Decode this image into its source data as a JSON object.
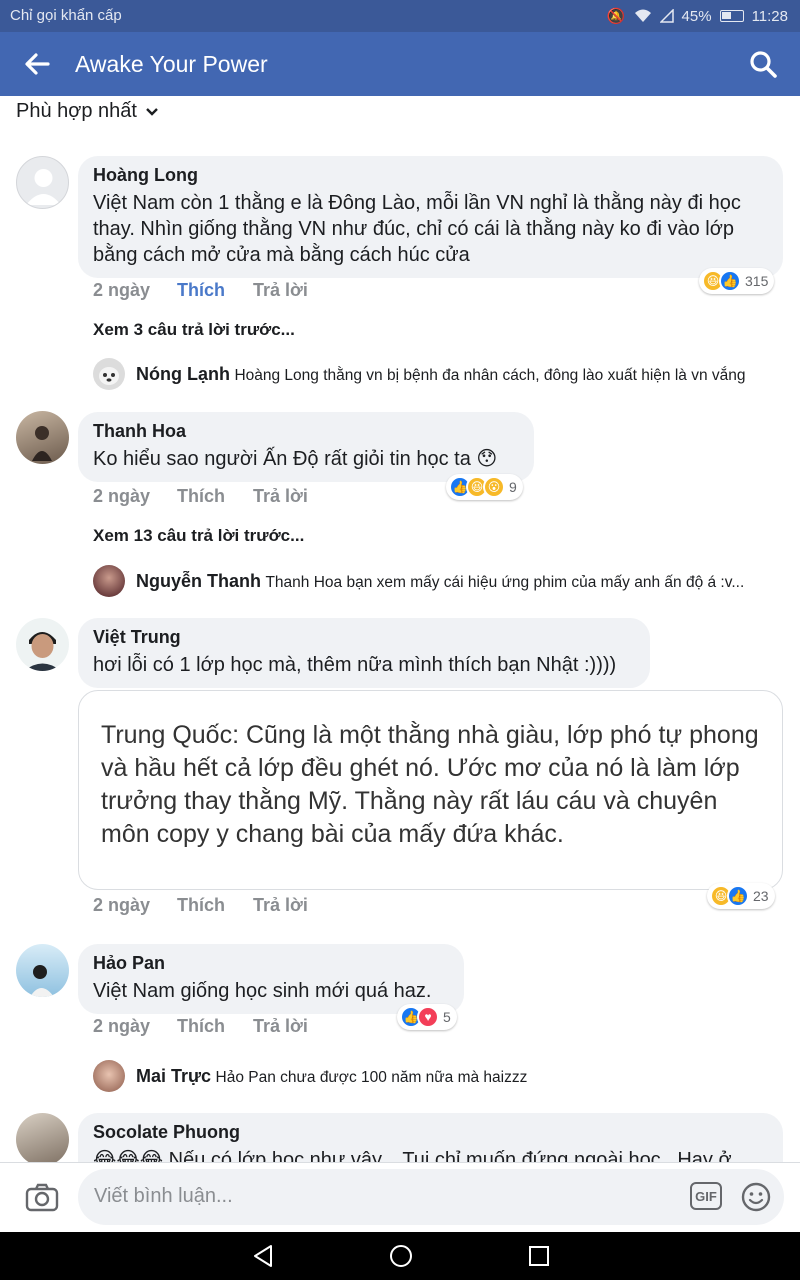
{
  "status_bar": {
    "carrier": "Chỉ gọi khẩn cấp",
    "battery": "45%",
    "time": "11:28"
  },
  "header": {
    "title": "Awake Your Power",
    "back_icon": "arrow-left-icon",
    "search_icon": "search-icon"
  },
  "sort": {
    "label": "Phù hợp nhất"
  },
  "actions": {
    "time": "2 ngày",
    "like": "Thích",
    "reply": "Trả lời"
  },
  "comments": [
    {
      "name": "Hoàng Long",
      "text": "Việt Nam còn 1 thằng e là Đông Lào, mỗi lần VN nghỉ là thằng này đi học thay. Nhìn giống thằng VN như đúc, chỉ có cái là thằng này ko đi vào lớp bằng cách mở cửa mà bằng cách húc cửa",
      "liked": true,
      "reactions": {
        "count": "315",
        "types": [
          "haha",
          "like"
        ]
      },
      "more_replies": "Xem 3 câu trả lời trước...",
      "reply": {
        "name": "Nóng Lạnh",
        "text": "Hoàng Long thằng vn bị bệnh đa nhân cách, đông lào xuất hiện là vn vắng"
      }
    },
    {
      "name": "Thanh Hoa",
      "text": "Ko hiểu sao người Ấn Độ rất giỏi tin học ta 😯",
      "liked": false,
      "reactions": {
        "count": "9",
        "types": [
          "like",
          "haha",
          "wow"
        ]
      },
      "more_replies": "Xem 13 câu trả lời trước...",
      "reply": {
        "name": "Nguyễn Thanh",
        "text": "Thanh Hoa bạn xem mấy cái hiệu ứng phim của mấy anh ấn độ á :v..."
      }
    },
    {
      "name": "Việt Trung",
      "text": "hơi lỗi có 1 lớp học mà, thêm nữa mình thích bạn Nhật :))))",
      "image_text": "Trung Quốc: Cũng là một thằng nhà giàu, lớp phó tự phong và hầu hết cả lớp đều ghét nó. Ước mơ của nó là làm lớp trưởng thay thằng Mỹ. Thằng này rất láu cáu và chuyên môn copy y chang bài của mấy đứa khác.",
      "liked": false,
      "reactions": {
        "count": "23",
        "types": [
          "haha",
          "like"
        ]
      }
    },
    {
      "name": "Hảo Pan",
      "text": "Việt Nam giống học sinh mới quá haz.",
      "liked": false,
      "reactions": {
        "count": "5",
        "types": [
          "like",
          "love"
        ]
      },
      "reply": {
        "name": "Mai Trực",
        "text": "Hảo Pan chưa được 100 năm nữa mà haizzz"
      }
    },
    {
      "name": "Socolate Phuong",
      "text": "😂😂😂 Nếu có lớp học như vậy... Tui chỉ muốn đứng ngoài học.. Hay ở"
    }
  ],
  "composer": {
    "placeholder": "Viết bình luận...",
    "gif": "GIF",
    "camera_icon": "camera-icon",
    "emoji_icon": "emoji-icon"
  },
  "colors": {
    "header": "#4267b2",
    "status_bar": "#3b5998",
    "bubble": "#f0f2f5",
    "liked": "#4a79c9",
    "muted": "#8a8d91"
  }
}
